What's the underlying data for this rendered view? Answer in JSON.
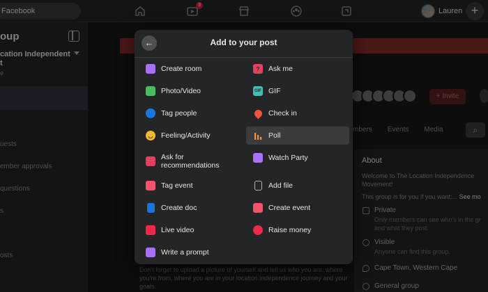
{
  "topbar": {
    "search_text": "Facebook",
    "notification_count": "3",
    "profile_name": "Lauren",
    "create_label": "+"
  },
  "sidebar": {
    "title": "oup",
    "group_name": "cation Independent\nt",
    "sub_text": "e",
    "items": [
      "uests",
      "ember approvals",
      "questions",
      "s",
      "osts"
    ]
  },
  "group_page": {
    "invite_label": "+ Invite",
    "tabs": [
      "mbers",
      "Events",
      "Media"
    ],
    "about": {
      "heading": "About",
      "description": "Welcome to The Location Independence Movement!",
      "description2": "This group is for you if you want:... ",
      "see_more": "See mo",
      "private_title": "Private",
      "private_desc": "Only members can see who's in the gr and what they post.",
      "visible_title": "Visible",
      "visible_desc": "Anyone can find this group.",
      "location": "Cape Town, Western Cape",
      "type": "General group"
    },
    "post_hint": "Don't forget to upload a picture of yourself and tell us who you are, where you're from, where you are in your location independence journey and your goals."
  },
  "modal": {
    "back_icon": "arrow-left-icon",
    "title": "Add to your post",
    "options": [
      {
        "label": "Create room",
        "icon": "video-room-icon",
        "color": "#a970ff"
      },
      {
        "label": "Ask me",
        "icon": "question-icon",
        "color": "#e4405f"
      },
      {
        "label": "Photo/Video",
        "icon": "photo-icon",
        "color": "#45bd62"
      },
      {
        "label": "GIF",
        "icon": "gif-icon",
        "color": "#3ec2b6"
      },
      {
        "label": "Tag people",
        "icon": "tag-people-icon",
        "color": "#1b74e4"
      },
      {
        "label": "Check in",
        "icon": "location-pin-icon",
        "color": "#f5533d"
      },
      {
        "label": "Feeling/Activity",
        "icon": "smiley-icon",
        "color": "#f7b928"
      },
      {
        "label": "Poll",
        "icon": "poll-icon",
        "color": "#f7923b"
      },
      {
        "label": "Ask for recommendations",
        "icon": "recommendation-icon",
        "color": "#e4405f"
      },
      {
        "label": "Watch Party",
        "icon": "watch-party-icon",
        "color": "#a970ff"
      },
      {
        "label": "Tag event",
        "icon": "calendar-icon",
        "color": "#f35369"
      },
      {
        "label": "Add file",
        "icon": "file-icon",
        "color": "#b0b3b8"
      },
      {
        "label": "Create doc",
        "icon": "doc-icon",
        "color": "#1b74e4"
      },
      {
        "label": "Create event",
        "icon": "calendar-event-icon",
        "color": "#f35369"
      },
      {
        "label": "Live video",
        "icon": "live-video-icon",
        "color": "#f02849"
      },
      {
        "label": "Raise money",
        "icon": "fundraiser-icon",
        "color": "#f02849"
      },
      {
        "label": "Write a prompt",
        "icon": "prompt-icon",
        "color": "#a970ff"
      }
    ],
    "highlighted": "Poll"
  }
}
